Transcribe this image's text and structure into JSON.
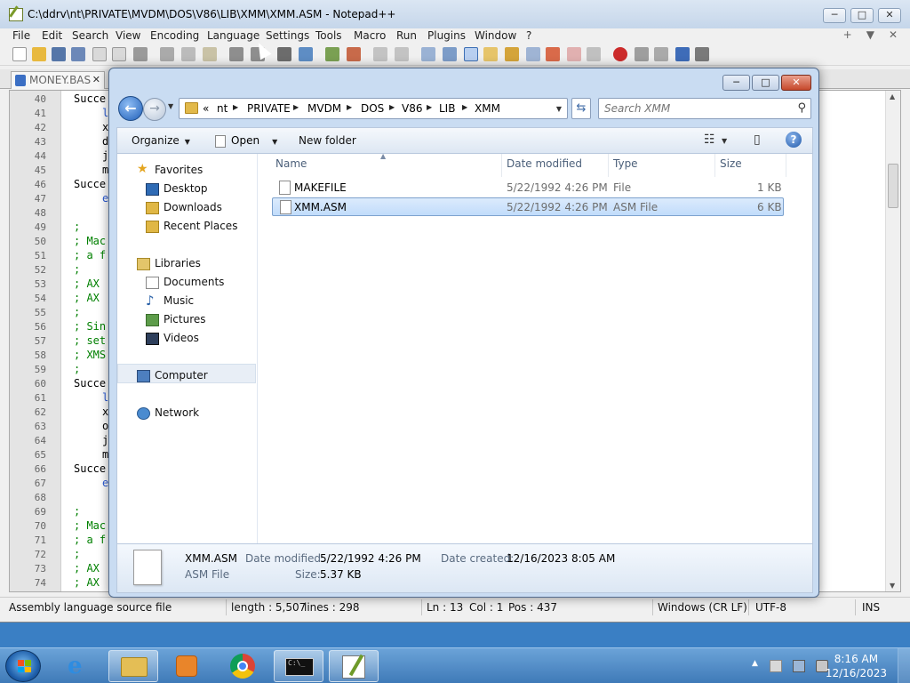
{
  "npp": {
    "title": "C:\\ddrv\\nt\\PRIVATE\\MVDM\\DOS\\V86\\LIB\\XMM\\XMM.ASM - Notepad++",
    "menu": [
      "File",
      "Edit",
      "Search",
      "View",
      "Encoding",
      "Language",
      "Settings",
      "Tools",
      "Macro",
      "Run",
      "Plugins",
      "Window",
      "?"
    ],
    "menu_right": [
      "+",
      "▼",
      "✕"
    ],
    "tab_label": "MONEY.BAS",
    "line_numbers": [
      "40",
      "41",
      "42",
      "43",
      "44",
      "45",
      "46",
      "47",
      "48",
      "49",
      "50",
      "51",
      "52",
      "53",
      "54",
      "55",
      "56",
      "57",
      "58",
      "59",
      "60",
      "61",
      "62",
      "63",
      "64",
      "65",
      "66",
      "67",
      "68",
      "69",
      "70",
      "71",
      "72",
      "73",
      "74"
    ],
    "code_lines": [
      {
        "text": "Succe",
        "type": "kw",
        "indent": 0
      },
      {
        "text": "l",
        "type": "bl",
        "indent": 1
      },
      {
        "text": "x",
        "type": "kw",
        "indent": 1
      },
      {
        "text": "d",
        "type": "kw",
        "indent": 1
      },
      {
        "text": "j",
        "type": "kw",
        "indent": 1
      },
      {
        "text": "m",
        "type": "kw",
        "indent": 1
      },
      {
        "text": "Succe",
        "type": "kw",
        "indent": 0
      },
      {
        "text": "e",
        "type": "bl",
        "indent": 1
      },
      {
        "text": "",
        "type": "kw",
        "indent": 0
      },
      {
        "text": ";",
        "type": "cm",
        "indent": 0
      },
      {
        "text": "; Mac",
        "type": "cm",
        "indent": 0
      },
      {
        "text": "; a f",
        "type": "cm",
        "indent": 0
      },
      {
        "text": ";",
        "type": "cm",
        "indent": 0
      },
      {
        "text": "; AX",
        "type": "cm",
        "indent": 0
      },
      {
        "text": "; AX",
        "type": "cm",
        "indent": 0
      },
      {
        "text": ";",
        "type": "cm",
        "indent": 0
      },
      {
        "text": "; Sin",
        "type": "cm",
        "indent": 0
      },
      {
        "text": "; set",
        "type": "cm",
        "indent": 0
      },
      {
        "text": "; XMS",
        "type": "cm",
        "indent": 0
      },
      {
        "text": ";",
        "type": "cm",
        "indent": 0
      },
      {
        "text": "Succe",
        "type": "kw",
        "indent": 0
      },
      {
        "text": "l",
        "type": "bl",
        "indent": 1
      },
      {
        "text": "x",
        "type": "kw",
        "indent": 1
      },
      {
        "text": "o",
        "type": "kw",
        "indent": 1
      },
      {
        "text": "j",
        "type": "kw",
        "indent": 1
      },
      {
        "text": "m",
        "type": "kw",
        "indent": 1
      },
      {
        "text": "Succe",
        "type": "kw",
        "indent": 0
      },
      {
        "text": "e",
        "type": "bl",
        "indent": 1
      },
      {
        "text": "",
        "type": "kw",
        "indent": 0
      },
      {
        "text": ";",
        "type": "cm",
        "indent": 0
      },
      {
        "text": "; Mac",
        "type": "cm",
        "indent": 0
      },
      {
        "text": "; a f",
        "type": "cm",
        "indent": 0
      },
      {
        "text": ";",
        "type": "cm",
        "indent": 0
      },
      {
        "text": "; AX",
        "type": "cm",
        "indent": 0
      },
      {
        "text": "; AX",
        "type": "cm",
        "indent": 0
      }
    ],
    "status": {
      "file_type": "Assembly language source file",
      "length": "length : 5,507",
      "lines": "lines : 298",
      "ln": "Ln : 13",
      "col": "Col : 1",
      "pos": "Pos : 437",
      "eol": "Windows (CR LF)",
      "encoding": "UTF-8",
      "mode": "INS"
    }
  },
  "dialog": {
    "back_glyph": "←",
    "crumb_prefix": "«",
    "breadcrumb": [
      "nt",
      "PRIVATE",
      "MVDM",
      "DOS",
      "V86",
      "LIB",
      "XMM"
    ],
    "search_placeholder": "Search XMM",
    "organize": "Organize",
    "open": "Open",
    "new_folder": "New folder",
    "help": "?",
    "nav": {
      "favorites": "Favorites",
      "desktop": "Desktop",
      "downloads": "Downloads",
      "recent": "Recent Places",
      "libraries": "Libraries",
      "documents": "Documents",
      "music": "Music",
      "pictures": "Pictures",
      "videos": "Videos",
      "computer": "Computer",
      "network": "Network"
    },
    "columns": {
      "name": "Name",
      "date": "Date modified",
      "type": "Type",
      "size": "Size"
    },
    "files": [
      {
        "name": "MAKEFILE",
        "date": "5/22/1992 4:26 PM",
        "type": "File",
        "size": "1 KB"
      },
      {
        "name": "XMM.ASM",
        "date": "5/22/1992 4:26 PM",
        "type": "ASM File",
        "size": "6 KB"
      }
    ],
    "details": {
      "name": "XMM.ASM",
      "type": "ASM File",
      "date_modified_label": "Date modified:",
      "date_modified": "5/22/1992 4:26 PM",
      "size_label": "Size:",
      "size": "5.37 KB",
      "date_created_label": "Date created:",
      "date_created": "12/16/2023 8:05 AM"
    }
  },
  "taskbar": {
    "time": "8:16 AM",
    "date": "12/16/2023",
    "buttons": [
      "internet-explorer",
      "file-explorer",
      "media-player",
      "chrome",
      "command-prompt",
      "notepad-plus-plus"
    ]
  },
  "colors": {
    "accent": "#3a7fc4",
    "selection": "#c1dcfb",
    "comment": "#008000"
  }
}
